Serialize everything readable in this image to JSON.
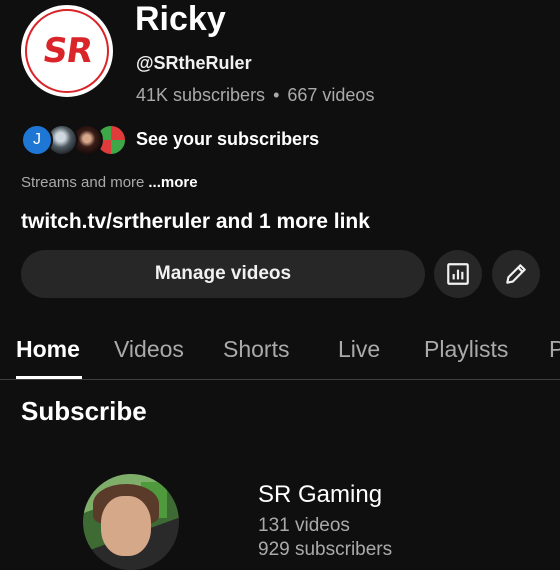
{
  "channel": {
    "avatar_text": "SR",
    "name": "Ricky",
    "handle": "@SRtheRuler",
    "subscribers": "41K subscribers",
    "separator": "•",
    "videos": "667 videos"
  },
  "subscribers_row": {
    "first_avatar_letter": "J",
    "label": "See your subscribers"
  },
  "description": {
    "text": "Streams and more",
    "more_label": "...more"
  },
  "links_text": "twitch.tv/srtheruler and 1 more link",
  "actions": {
    "manage_label": "Manage videos",
    "analytics_icon": "analytics-icon",
    "edit_icon": "pencil-icon"
  },
  "tabs": [
    {
      "label": "Home",
      "active": true
    },
    {
      "label": "Videos",
      "active": false
    },
    {
      "label": "Shorts",
      "active": false
    },
    {
      "label": "Live",
      "active": false
    },
    {
      "label": "Playlists",
      "active": false
    },
    {
      "label": "P",
      "active": false
    }
  ],
  "section": {
    "title": "Subscribe"
  },
  "featured_channel": {
    "name": "SR Gaming",
    "videos": "131 videos",
    "subscribers": "929 subscribers"
  },
  "colors": {
    "background": "#0f0f0f",
    "button_bg": "#272727",
    "secondary_text": "#aaaaaa",
    "brand_red": "#d9252a"
  }
}
